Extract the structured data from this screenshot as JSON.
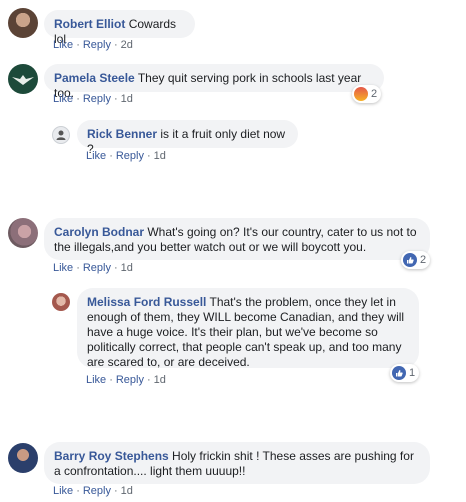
{
  "comments": [
    {
      "name": "Robert Elliot",
      "text": "Cowards lol",
      "like": "Like",
      "reply": "Reply",
      "time": "2d"
    },
    {
      "name": "Pamela Steele",
      "text": "They quit serving pork in schools last year too.",
      "like": "Like",
      "reply": "Reply",
      "time": "1d",
      "reaction_count": "2",
      "reaction_icon": "angry-icon"
    },
    {
      "name": "Rick Benner",
      "text": "is it a fruit only diet now ?",
      "like": "Like",
      "reply": "Reply",
      "time": "1d"
    },
    {
      "name": "Carolyn Bodnar",
      "text": "What's going on? It's our country, cater to us not to the illegals,and you better watch out or we will boycott you.",
      "like": "Like",
      "reply": "Reply",
      "time": "1d",
      "reaction_count": "2",
      "reaction_icon": "like-icon"
    },
    {
      "name": "Melissa Ford Russell",
      "text": "That's the problem, once they let in enough of them, they WILL become Canadian, and they will have a huge voice. It's their plan, but we've become so politically correct, that people can't speak up, and too many are scared to, or are deceived.",
      "like": "Like",
      "reply": "Reply",
      "time": "1d",
      "reaction_count": "1",
      "reaction_icon": "like-icon"
    },
    {
      "name": "Barry Roy Stephens",
      "text": "Holy frickin shit ! These asses are pushing for a confrontation.... light them uuuup!!",
      "like": "Like",
      "reply": "Reply",
      "time": "1d"
    }
  ],
  "colors": {
    "name": "#385898",
    "bubble": "#f2f3f5",
    "meta": "#606770",
    "like_blue": "#4267b2"
  }
}
